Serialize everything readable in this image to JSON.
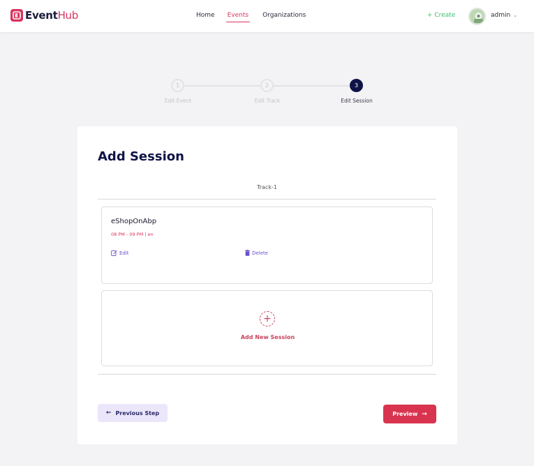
{
  "brand": {
    "name_bold": "Event",
    "name_light": "Hub",
    "color": "#d8345f"
  },
  "nav": {
    "items": [
      {
        "label": "Home",
        "active": false
      },
      {
        "label": "Events",
        "active": true
      },
      {
        "label": "Organizations",
        "active": false
      }
    ]
  },
  "header": {
    "create_label": "+ Create",
    "user_name": "admin",
    "user_chevron": "⌄"
  },
  "stepper": {
    "steps": [
      {
        "number": "1",
        "label": "Edit Event",
        "active": false
      },
      {
        "number": "2",
        "label": "Edit Track",
        "active": false
      },
      {
        "number": "3",
        "label": "Edit Session",
        "active": true
      }
    ]
  },
  "page": {
    "title": "Add Session",
    "track_label": "Track-1"
  },
  "session": {
    "title": "eShopOnAbp",
    "meta": "08 PM - 09 PM | en",
    "edit_label": "Edit",
    "delete_label": "Delete"
  },
  "add_session": {
    "icon": "+",
    "label": "Add New Session"
  },
  "footer": {
    "previous_label": "Previous Step",
    "previous_arrow": "←",
    "preview_label": "Preview",
    "preview_arrow": "→"
  },
  "colors": {
    "accent": "#d8345f",
    "navy": "#0f1447",
    "create_green": "#3dbf6e",
    "action_purple": "#6a4fd0"
  }
}
